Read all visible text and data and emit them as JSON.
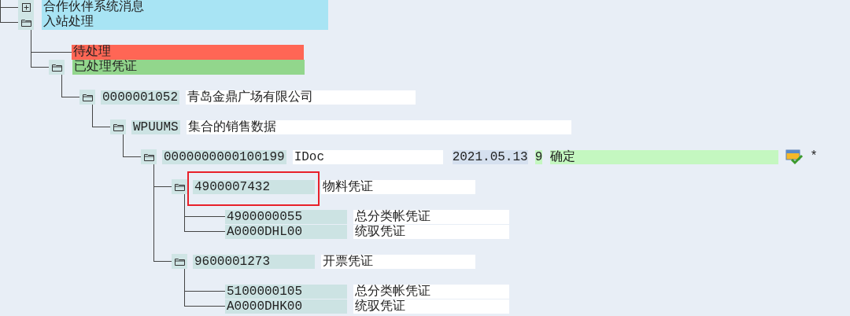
{
  "tree": [
    {
      "kind": "group",
      "expanded": false,
      "text": "合作伙伴系统消息",
      "color": "#a8e4f4"
    },
    {
      "kind": "group",
      "expanded": true,
      "text": "入站处理",
      "color": "#a8e4f4",
      "children": [
        {
          "kind": "label",
          "text": "待处理",
          "color": "#ff6655"
        },
        {
          "kind": "group",
          "expanded": true,
          "text": "已处理凭证",
          "color": "#92d68c",
          "children": [
            {
              "kind": "object",
              "expanded": true,
              "key": "0000001052",
              "text": "青岛金鼎广场有限公司",
              "children": [
                {
                  "kind": "object",
                  "expanded": true,
                  "key": "WPUUMS",
                  "text": "集合的销售数据",
                  "children": [
                    {
                      "kind": "idoc",
                      "expanded": true,
                      "key": "0000000000100199",
                      "text": "IDoc",
                      "date": "2021.05.13",
                      "status": "9",
                      "status_text": "确定",
                      "flag": "*",
                      "children": [
                        {
                          "kind": "doc",
                          "expanded": true,
                          "key": "4900007432",
                          "text": "物料凭证",
                          "highlighted": true,
                          "children": [
                            {
                              "kind": "entry",
                              "key": "4900000055",
                              "text": "总分类帐凭证"
                            },
                            {
                              "kind": "entry",
                              "key": "A0000DHL00",
                              "text": "统驭凭证"
                            }
                          ]
                        },
                        {
                          "kind": "doc",
                          "expanded": true,
                          "key": "9600001273",
                          "text": "开票凭证",
                          "highlighted": false,
                          "children": [
                            {
                              "kind": "entry",
                              "key": "5100000105",
                              "text": "总分类帐凭证"
                            },
                            {
                              "kind": "entry",
                              "key": "A0000DHK00",
                              "text": "统驭凭证"
                            }
                          ]
                        }
                      ]
                    }
                  ]
                }
              ]
            }
          ]
        }
      ]
    }
  ]
}
